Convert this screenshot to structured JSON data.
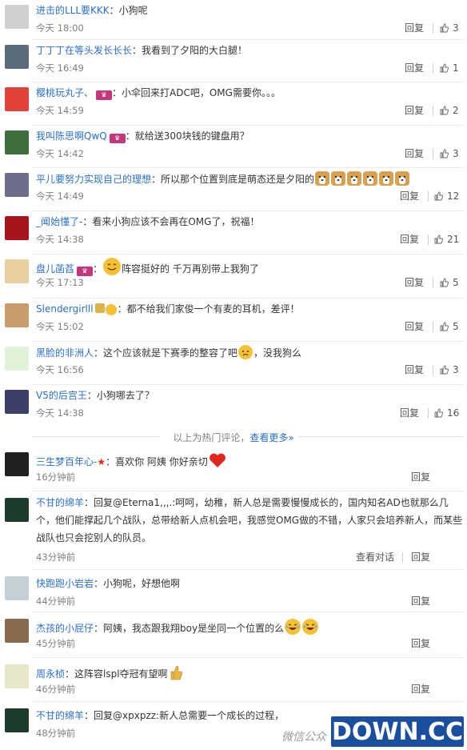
{
  "comments": [
    {
      "name": "进击的LLL要KKK",
      "badge": "",
      "text": "：小狗呢",
      "emoji_after": [],
      "time": "今天 18:00",
      "reply": "回复",
      "likes": "3",
      "avatar_color": "#cfcfcf"
    },
    {
      "name": "丁丁丁在等头发长长长",
      "badge": "",
      "text": "：我看到了夕阳的大白腿！",
      "emoji_after": [],
      "time": "今天 16:49",
      "reply": "回复",
      "likes": "1",
      "avatar_color": "#5a6b7a"
    },
    {
      "name": "樱桃玩丸子、",
      "badge": "wbadge",
      "text": "：小伞回来打ADC吧，OMG需要你。。。",
      "emoji_after": [],
      "time": "今天 14:59",
      "reply": "回复",
      "likes": "2",
      "avatar_color": "#e2413a"
    },
    {
      "name": "我叫陈思啊QwQ",
      "badge": "wbadge",
      "text": "：就给送300块钱的键盘用？",
      "emoji_after": [],
      "time": "今天 14:42",
      "reply": "回复",
      "likes": "3",
      "avatar_color": "#3f6e3e"
    },
    {
      "name": "平儿要努力实现自己的理想",
      "badge": "",
      "text": "：所以那个位置到底是萌态还是夕阳的",
      "emoji_after": [
        "dog",
        "dog",
        "dog",
        "dog",
        "dog",
        "dog"
      ],
      "time": "今天 14:49",
      "reply": "回复",
      "likes": "12",
      "avatar_color": "#6d6d8c"
    },
    {
      "name": "_闻始懂了-",
      "badge": "",
      "text": "：看来小狗应该不会再在OMG了，祝福！",
      "emoji_after": [],
      "time": "今天 14:38",
      "reply": "回复",
      "likes": "21",
      "avatar_color": "#a8141c"
    },
    {
      "name": "盘儿菡萏",
      "badge": "wbadge",
      "text": "：",
      "emoji_after": [],
      "text2": "阵容挺好的 千万再别带上我狗了",
      "emoji_mid": "smile",
      "time": "今天 17:13",
      "reply": "回复",
      "likes": "5",
      "avatar_color": "#e8cfa0"
    },
    {
      "name": "Slendergirlll",
      "badge": "vbadge",
      "text": "：都不给我们家俊一个有麦的耳机，差评！",
      "emoji_after": [],
      "time": "今天 15:02",
      "reply": "回复",
      "likes": "5",
      "avatar_color": "#c79c6a"
    },
    {
      "name": "黑脸的非洲人",
      "badge": "",
      "text": "：这个应该就是下赛季的整容了吧",
      "emoji_after": [
        "sad"
      ],
      "text2": "，没我狗么",
      "time": "今天 16:56",
      "reply": "回复",
      "likes": "3",
      "avatar_color": "#dff2d8"
    },
    {
      "name": "V5的后宫王",
      "badge": "",
      "text": "：小狗哪去了？",
      "emoji_after": [],
      "time": "今天 14:38",
      "reply": "回复",
      "likes": "16",
      "avatar_color": "#3b3f6a"
    }
  ],
  "hot_divider": {
    "text": "以上为热门评论，",
    "more": "查看更多»"
  },
  "recent": [
    {
      "name": "三生梦百年心-",
      "badge": "star",
      "text": "：喜欢你 阿姨 你好亲切",
      "emoji_after": [
        "heart"
      ],
      "time": "16分钟前",
      "reply": "回复",
      "avatar_color": "#202020"
    },
    {
      "name": "不甘的绵羊",
      "badge": "",
      "text": "：回复@Eterna1,,,.:呵呵，幼稚，新人总是需要慢慢成长的，国内知名AD也就那么几个，他们能撑起几个战队，总带给新人点机会吧，我感觉OMG做的不错，人家只会培养新人，而某些战队也只会挖别人的队员。",
      "time": "43分钟前",
      "reply": "回复",
      "dialog": "查看对话",
      "avatar_color": "#1d3b2a"
    },
    {
      "name": "快跑跑小岩岩",
      "badge": "",
      "text": "：小狗呢，好想他啊",
      "emoji_after": [],
      "time": "44分钟前",
      "reply": "回复",
      "avatar_color": "#c5cfd6"
    },
    {
      "name": "杰孩的小屁仔",
      "badge": "",
      "text": "：阿姨，我态跟我翔boy是坐同一个位置的么",
      "emoji_after": [
        "laugh",
        "laugh"
      ],
      "time": "45分钟前",
      "reply": "回复",
      "avatar_color": "#8a6a4e"
    },
    {
      "name": "周永桢",
      "badge": "",
      "text": "：这阵容lspl夺冠有望啊",
      "emoji_after": [
        "thumbsup"
      ],
      "time": "46分钟前",
      "reply": "回复",
      "avatar_color": "#e8e6c8"
    },
    {
      "name": "不甘的绵羊",
      "badge": "",
      "text": "：回复@xpxpzz:新人总需要一个成长的过程，",
      "emoji_after": [],
      "time": "48分钟前",
      "reply": "回复",
      "avatar_color": "#1d3b2a"
    }
  ],
  "watermark": {
    "cn": "微信公众",
    "brand": "DOWN.CC"
  },
  "colors": {
    "name": "#2a6fcb",
    "time": "#808080",
    "text": "#333333",
    "sep": "#eaeaea",
    "watermark_bg": "#1a4fa0"
  }
}
